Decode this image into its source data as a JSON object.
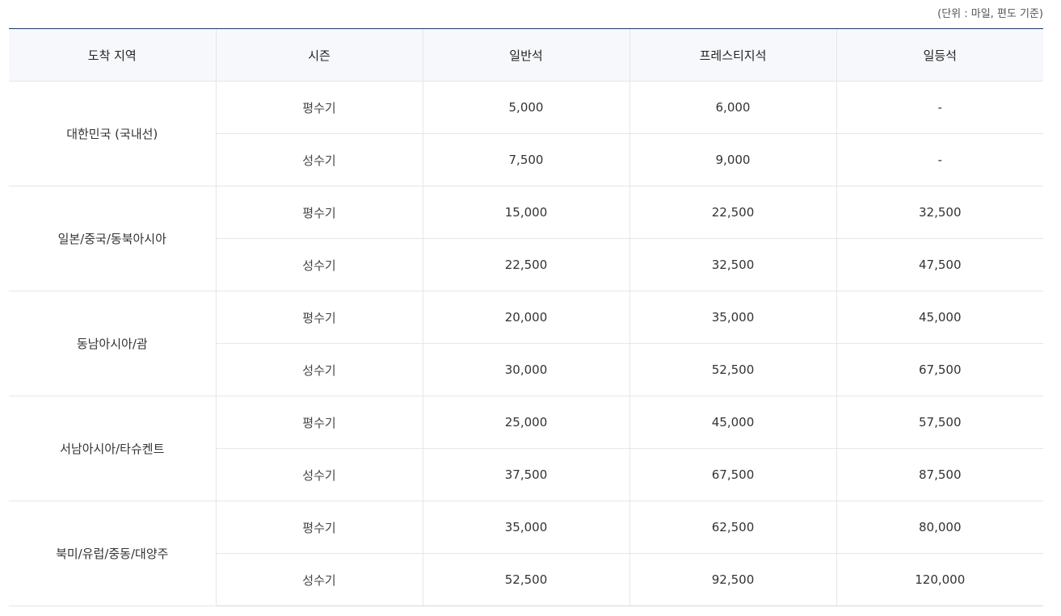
{
  "unit_note": "(단위 : 마일, 편도 기준)",
  "headers": [
    "도착 지역",
    "시즌",
    "일반석",
    "프레스티지석",
    "일등석"
  ],
  "regions": [
    {
      "name": "대한민국 (국내선)",
      "rows": [
        {
          "season": "평수기",
          "economy": "5,000",
          "prestige": "6,000",
          "first": "-"
        },
        {
          "season": "성수기",
          "economy": "7,500",
          "prestige": "9,000",
          "first": "-"
        }
      ]
    },
    {
      "name": "일본/중국/동북아시아",
      "rows": [
        {
          "season": "평수기",
          "economy": "15,000",
          "prestige": "22,500",
          "first": "32,500"
        },
        {
          "season": "성수기",
          "economy": "22,500",
          "prestige": "32,500",
          "first": "47,500"
        }
      ]
    },
    {
      "name": "동남아시아/괌",
      "rows": [
        {
          "season": "평수기",
          "economy": "20,000",
          "prestige": "35,000",
          "first": "45,000"
        },
        {
          "season": "성수기",
          "economy": "30,000",
          "prestige": "52,500",
          "first": "67,500"
        }
      ]
    },
    {
      "name": "서남아시아/타슈켄트",
      "rows": [
        {
          "season": "평수기",
          "economy": "25,000",
          "prestige": "45,000",
          "first": "57,500"
        },
        {
          "season": "성수기",
          "economy": "37,500",
          "prestige": "67,500",
          "first": "87,500"
        }
      ]
    },
    {
      "name": "북미/유럽/중동/대양주",
      "rows": [
        {
          "season": "평수기",
          "economy": "35,000",
          "prestige": "62,500",
          "first": "80,000"
        },
        {
          "season": "성수기",
          "economy": "52,500",
          "prestige": "92,500",
          "first": "120,000"
        }
      ]
    }
  ]
}
